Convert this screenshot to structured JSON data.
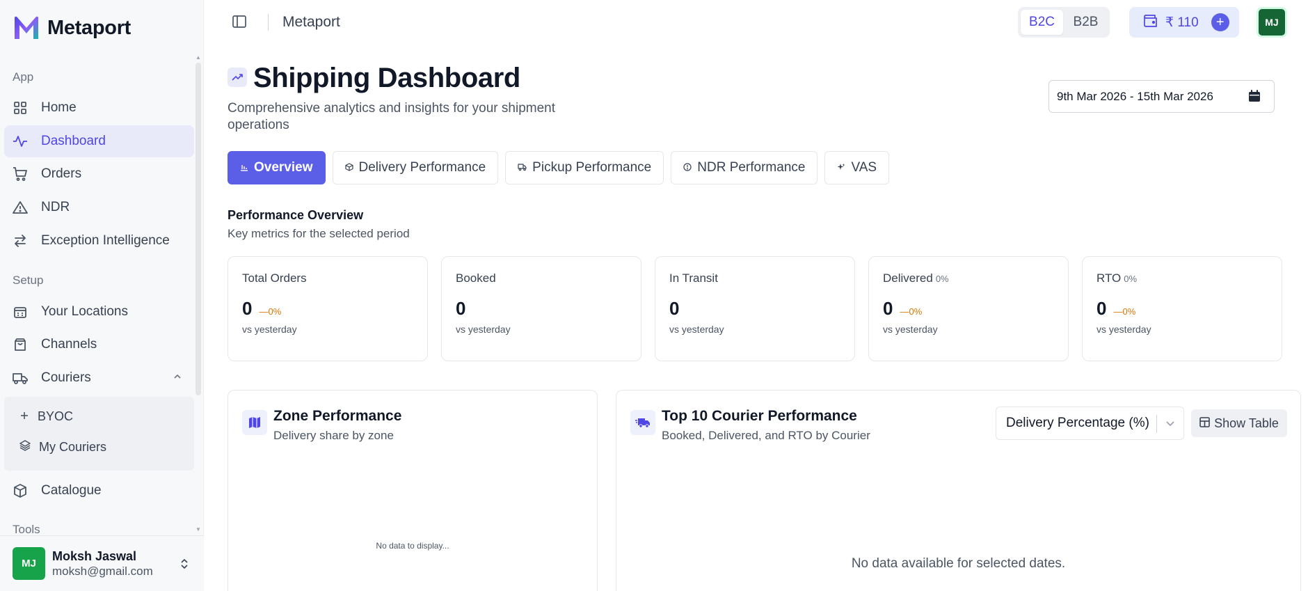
{
  "brand": {
    "name": "Metaport"
  },
  "sidebar": {
    "sections": {
      "app": "App",
      "setup": "Setup",
      "tools": "Tools"
    },
    "items": [
      {
        "label": "Home",
        "icon": "grid-icon"
      },
      {
        "label": "Dashboard",
        "icon": "activity-icon",
        "active": true
      },
      {
        "label": "Orders",
        "icon": "cart-icon"
      },
      {
        "label": "NDR",
        "icon": "warning-icon"
      },
      {
        "label": "Exception Intelligence",
        "icon": "arrows-icon"
      },
      {
        "label": "Your Locations",
        "icon": "building-icon"
      },
      {
        "label": "Channels",
        "icon": "bag-icon"
      },
      {
        "label": "Couriers",
        "icon": "truck-icon"
      },
      {
        "label": "Catalogue",
        "icon": "package-icon"
      }
    ],
    "sub_items": [
      {
        "label": "BYOC",
        "icon": "plus-icon"
      },
      {
        "label": "My Couriers",
        "icon": "layers-icon"
      }
    ],
    "user": {
      "initials": "MJ",
      "name": "Moksh Jaswal",
      "email": "moksh@gmail.com"
    }
  },
  "header": {
    "title": "Metaport",
    "segments": [
      "B2C",
      "B2B"
    ],
    "active_segment": "B2C",
    "wallet_amount": "₹ 110",
    "avatar_initials": "MJ"
  },
  "page": {
    "title": "Shipping Dashboard",
    "subtitle": "Comprehensive analytics and insights for your shipment operations",
    "date_range": "9th Mar 2026 - 15th Mar 2026",
    "tabs": [
      {
        "label": "Overview",
        "active": true
      },
      {
        "label": "Delivery Performance"
      },
      {
        "label": "Pickup Performance"
      },
      {
        "label": "NDR Performance"
      },
      {
        "label": "VAS"
      }
    ],
    "overview_title": "Performance Overview",
    "overview_subtitle": "Key metrics for the selected period",
    "kpis": [
      {
        "label": "Total Orders",
        "pct": "",
        "value": "0",
        "change": "—0%",
        "compare": "vs yesterday"
      },
      {
        "label": "Booked",
        "pct": "",
        "value": "0",
        "change": "",
        "compare": "vs yesterday"
      },
      {
        "label": "In Transit",
        "pct": "",
        "value": "0",
        "change": "",
        "compare": "vs yesterday"
      },
      {
        "label": "Delivered",
        "pct": "0%",
        "value": "0",
        "change": "—0%",
        "compare": "vs yesterday"
      },
      {
        "label": "RTO",
        "pct": "0%",
        "value": "0",
        "change": "—0%",
        "compare": "vs yesterday"
      }
    ],
    "zone_card": {
      "title": "Zone Performance",
      "subtitle": "Delivery share by zone",
      "empty": "No data to display..."
    },
    "courier_card": {
      "title": "Top 10 Courier Performance",
      "subtitle": "Booked, Delivered, and RTO by Courier",
      "select_value": "Delivery Percentage (%)",
      "show_table": "Show Table",
      "empty": "No data available for selected dates."
    }
  },
  "colors": {
    "accent": "#5b5fe8",
    "active_bg": "#e9eaf9",
    "avatar": "#16a34a",
    "warning": "#d97706"
  }
}
